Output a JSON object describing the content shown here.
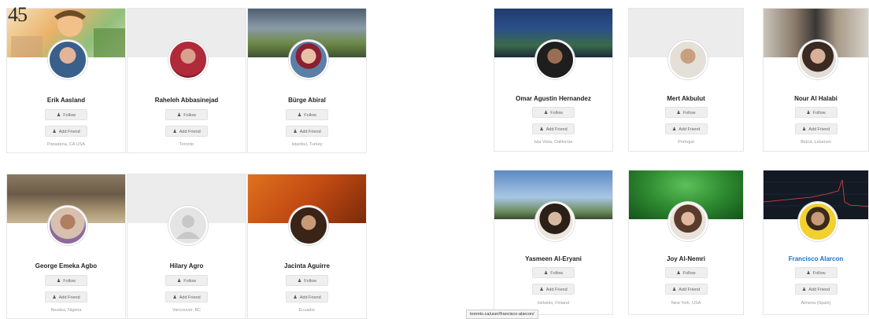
{
  "page_number": "45",
  "buttons": {
    "follow": "Follow",
    "add_friend": "Add Friend"
  },
  "status_url": "toronto.ca/user/francisco-alarcon/",
  "left_cards": [
    {
      "name": "Erik Aasland",
      "location": "Pasadena, CA USA",
      "cover": "illustration"
    },
    {
      "name": "Raheleh Abbasinejad",
      "location": "Toronto",
      "cover": "none"
    },
    {
      "name": "Bürge Abiral",
      "location": "Istanbul, Turkey",
      "cover": "landscape"
    },
    {
      "name": "George Emeka Agbo",
      "location": "Nsukka, Nigeria",
      "cover": "market"
    },
    {
      "name": "Hilary Agro",
      "location": "Vancouver, BC",
      "cover": "none"
    },
    {
      "name": "Jacinta Aguirre",
      "location": "Ecuador",
      "cover": "orange"
    }
  ],
  "right_cards": [
    {
      "name": "Omar Agustin Hernandez",
      "location": "Isla Vista, California",
      "cover": "city-night"
    },
    {
      "name": "Mert Akbulut",
      "location": "Portugal",
      "cover": "none"
    },
    {
      "name": "Nour Al Halabi",
      "location": "Beirut, Lebanon",
      "cover": "buildings"
    },
    {
      "name": "Yasmeen Al-Eryani",
      "location": "Helsinki, Finland",
      "cover": "sky"
    },
    {
      "name": "Joy Al-Nemri",
      "location": "New York, USA",
      "cover": "green"
    },
    {
      "name": "Francisco Alarcon",
      "location": "Almeria (Spain)",
      "cover": "dark-chart",
      "highlighted": true
    }
  ]
}
